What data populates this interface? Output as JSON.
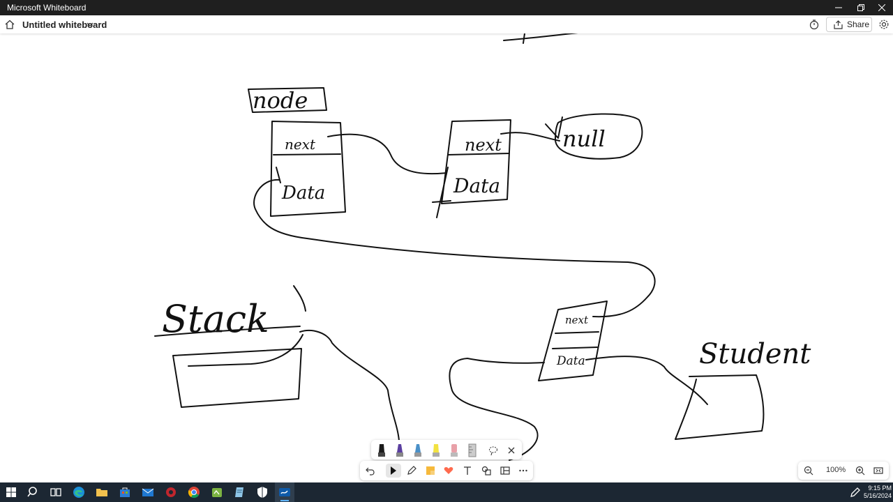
{
  "window": {
    "title": "Microsoft Whiteboard"
  },
  "header": {
    "board_name": "Untitled whiteboard",
    "share_label": "Share"
  },
  "whiteboard": {
    "ink_text": {
      "node": "node",
      "next_1": "next",
      "data_1": "Data",
      "next_2": "next",
      "data_2": "Data",
      "null": "null",
      "stack": "Stack",
      "next_3": "next",
      "data_3": "Data",
      "student": "Student"
    }
  },
  "pen_tray": {
    "pens": [
      {
        "name": "black-pen-icon",
        "color": "#1a1a1a"
      },
      {
        "name": "purple-pen-icon",
        "color": "#5b3fa0"
      },
      {
        "name": "blue-pen-icon",
        "color": "#4a90c8"
      },
      {
        "name": "highlighter-icon",
        "color": "#f2e240"
      },
      {
        "name": "eraser-icon",
        "color": "#e8a0a8"
      },
      {
        "name": "ruler-icon",
        "color": "#b0b0b0"
      }
    ]
  },
  "zoom": {
    "level": "100%"
  },
  "taskbar": {
    "time": "9:15 PM",
    "date": "5/16/2024"
  }
}
